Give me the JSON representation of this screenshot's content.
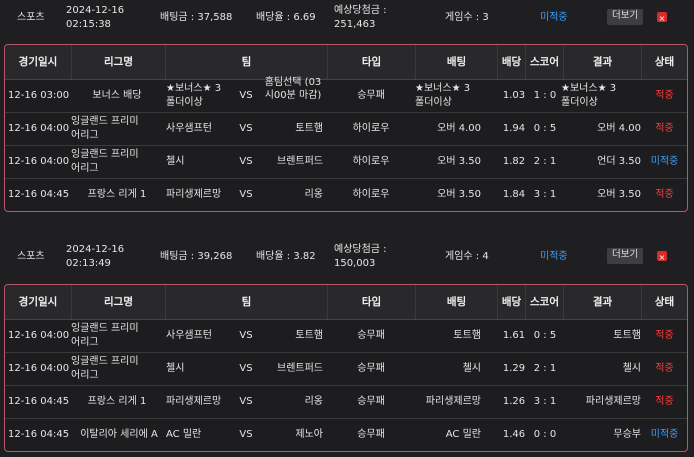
{
  "bets": [
    {
      "summary": {
        "sport": "스포츠",
        "date": "2024-12-16",
        "time": "02:15:38",
        "bet_amount": "배팅금 : 37,588",
        "odds": "배당율 : 6.69",
        "payout_label": "예상당첨금 :",
        "payout_value": "251,463",
        "game_count": "게임수 : 3",
        "status": "미적중",
        "detail_button": "더보기",
        "delete_button": "×"
      },
      "rows": [
        {
          "datetime": "12-16 03:00",
          "league": "보너스 배당",
          "home": "★보너스★ 3폴더이상",
          "vs": "VS",
          "away": "홈팀선택 (03시00분 마감)",
          "type": "승무패",
          "pick": "★보너스★ 3폴더이상",
          "rate": "1.03",
          "score": "1 : 0",
          "result": "★보너스★ 3폴더이상",
          "state": "적중"
        },
        {
          "datetime": "12-16 04:00",
          "league": "잉글랜드 프리미어리그",
          "home": "사우샘프턴",
          "vs": "VS",
          "away": "토트햄",
          "type": "하이로우",
          "pick": "오버 4.00",
          "rate": "1.94",
          "score": "0 : 5",
          "result": "오버 4.00",
          "state": "적중"
        },
        {
          "datetime": "12-16 04:00",
          "league": "잉글랜드 프리미어리그",
          "home": "첼시",
          "vs": "VS",
          "away": "브렌트퍼드",
          "type": "하이로우",
          "pick": "오버 3.50",
          "rate": "1.82",
          "score": "2 : 1",
          "result": "언더 3.50",
          "state": "미적중"
        },
        {
          "datetime": "12-16 04:45",
          "league": "프랑스 리게 1",
          "home": "파리생제르망",
          "vs": "VS",
          "away": "리옹",
          "type": "하이로우",
          "pick": "오버 3.50",
          "rate": "1.84",
          "score": "3 : 1",
          "result": "오버 3.50",
          "state": "적중"
        }
      ]
    },
    {
      "summary": {
        "sport": "스포츠",
        "date": "2024-12-16",
        "time": "02:13:49",
        "bet_amount": "배팅금 : 39,268",
        "odds": "배당율 : 3.82",
        "payout_label": "예상당첨금 :",
        "payout_value": "150,003",
        "game_count": "게임수 : 4",
        "status": "미적중",
        "detail_button": "더보기",
        "delete_button": "×"
      },
      "rows": [
        {
          "datetime": "12-16 04:00",
          "league": "잉글랜드 프리미어리그",
          "home": "사우샘프턴",
          "vs": "VS",
          "away": "토트햄",
          "type": "승무패",
          "pick": "토트햄",
          "rate": "1.61",
          "score": "0 : 5",
          "result": "토트햄",
          "state": "적중"
        },
        {
          "datetime": "12-16 04:00",
          "league": "잉글랜드 프리미어리그",
          "home": "첼시",
          "vs": "VS",
          "away": "브렌트퍼드",
          "type": "승무패",
          "pick": "첼시",
          "rate": "1.29",
          "score": "2 : 1",
          "result": "첼시",
          "state": "적중"
        },
        {
          "datetime": "12-16 04:45",
          "league": "프랑스 리게 1",
          "home": "파리생제르망",
          "vs": "VS",
          "away": "리옹",
          "type": "승무패",
          "pick": "파리생제르망",
          "rate": "1.26",
          "score": "3 : 1",
          "result": "파리생제르망",
          "state": "적중"
        },
        {
          "datetime": "12-16 04:45",
          "league": "이탈리아 세리에 A",
          "home": "AC 밀란",
          "vs": "VS",
          "away": "제노아",
          "type": "승무패",
          "pick": "AC 밀란",
          "rate": "1.46",
          "score": "0 : 0",
          "result": "무승부",
          "state": "미적중"
        }
      ]
    }
  ],
  "table_headers": [
    "경기일시",
    "리그명",
    "팀",
    "타입",
    "배팅",
    "배당",
    "스코어",
    "결과",
    "상태"
  ],
  "colors": {
    "hit": "#ff3b3b",
    "miss": "#39a0ff",
    "panel_border": "#b8566a",
    "delete": "#d92b2b"
  }
}
